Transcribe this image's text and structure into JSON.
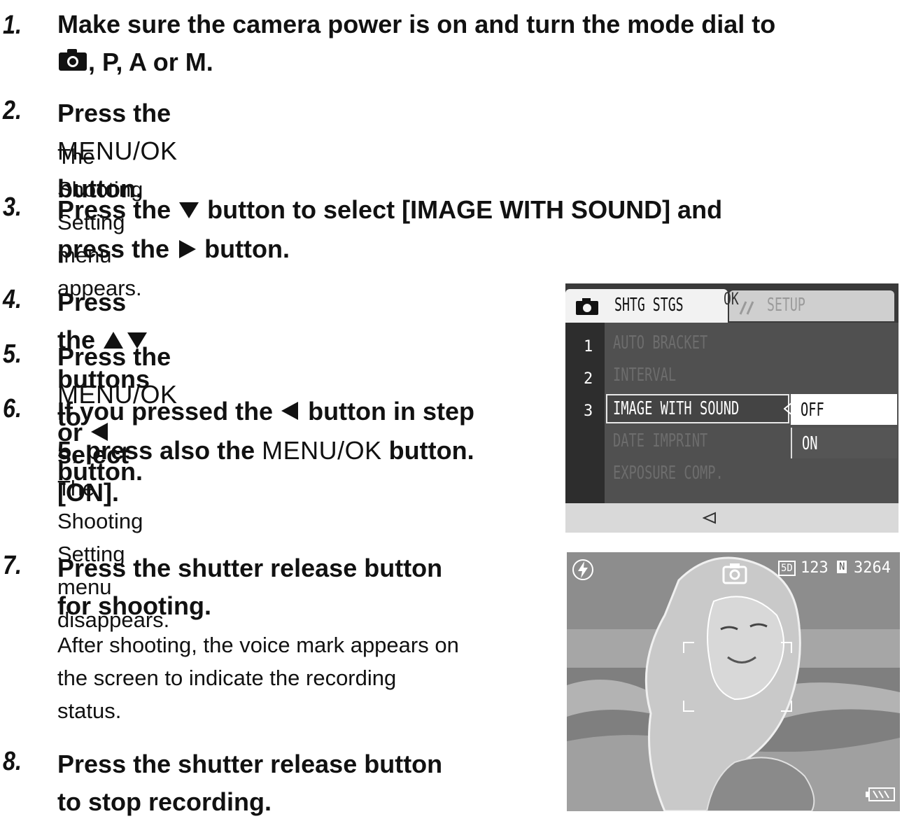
{
  "steps": [
    {
      "num": "1.",
      "title_a": "Make sure the camera power is on and turn the mode dial to",
      "title_b": ", P, A or M."
    },
    {
      "num": "2.",
      "title_pre": "Press the ",
      "menu_ok": "MENU/OK",
      "title_post": " button.",
      "desc": "The Shooting Setting menu appears."
    },
    {
      "num": "3.",
      "title_a": "Press the ",
      "title_a2": " button to select [IMAGE WITH SOUND] and",
      "title_b": "press the ",
      "title_b2": " button."
    },
    {
      "num": "4.",
      "title_pre": "Press the ",
      "title_post": " buttons to select [ON]."
    },
    {
      "num": "5.",
      "title_pre": "Press the ",
      "menu_ok": "MENU/OK",
      "title_mid": " or ",
      "title_post": " button."
    },
    {
      "num": "6.",
      "title_a": "If you pressed the ",
      "title_a2": " button in step",
      "title_b": "5, press also the ",
      "menu_ok": "MENU/OK",
      "title_b2": " button.",
      "desc": "The Shooting Setting menu disappears."
    },
    {
      "num": "7.",
      "title_a": "Press the shutter release button",
      "title_b": "for shooting.",
      "desc_lines": [
        "After shooting, the voice mark appears on",
        "the screen to indicate the recording",
        "status."
      ]
    },
    {
      "num": "8.",
      "title_a": "Press the shutter release button",
      "title_b": "to stop recording."
    }
  ],
  "menu_screen": {
    "tab_active": "SHTG STGS",
    "tab_inactive": "SETUP",
    "page_numbers": [
      "1",
      "2",
      "3"
    ],
    "items": [
      "AUTO BRACKET",
      "INTERVAL",
      "IMAGE WITH SOUND",
      "DATE IMPRINT",
      "EXPOSURE COMP."
    ],
    "options": [
      "OFF",
      "ON"
    ],
    "footer": "OK"
  },
  "live_screen": {
    "quality": "123",
    "quality_badge": "5D",
    "remaining": "3264",
    "remaining_badge": "N"
  }
}
